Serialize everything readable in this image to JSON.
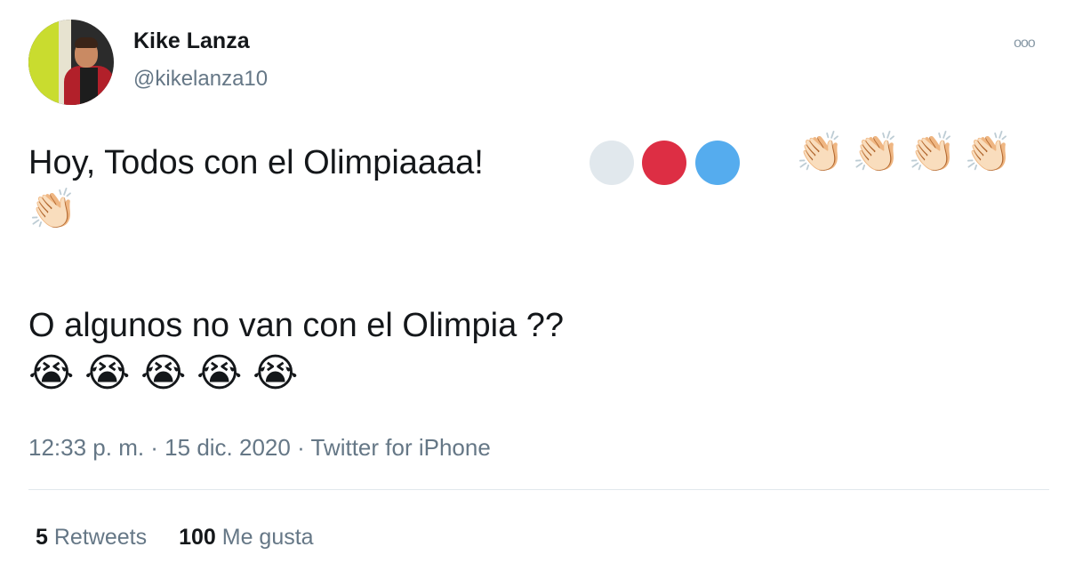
{
  "author": {
    "name": "Kike Lanza",
    "handle": "@kikelanza10"
  },
  "more_icon": "ooo",
  "tweet": {
    "line1": "Hoy, Todos con el Olimpiaaaa!",
    "line2": "O algunos no van con el Olimpia ??",
    "circle_colors": [
      "#e1e8ed",
      "#dd2e44",
      "#55acee"
    ],
    "clap_emoji": "👏🏻",
    "cry_emoji": "😭"
  },
  "meta": "12:33 p. m. · 15 dic. 2020 · Twitter for iPhone",
  "stats": {
    "retweets_count": "5",
    "retweets_label": "Retweets",
    "likes_count": "100",
    "likes_label": "Me gusta"
  }
}
